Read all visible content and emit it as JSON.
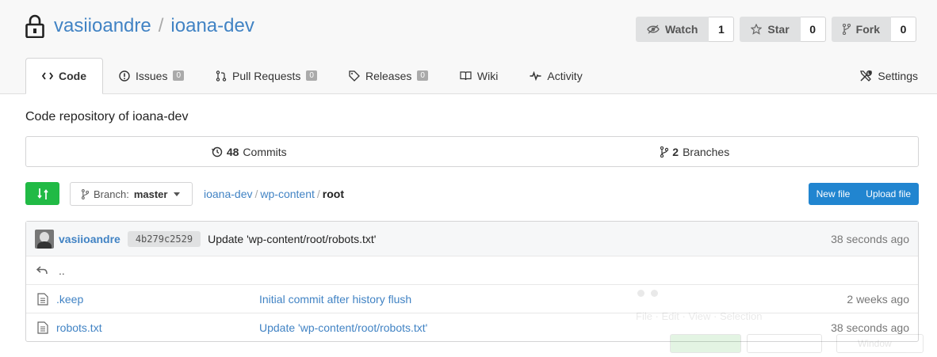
{
  "repo": {
    "owner": "vasiioandre",
    "separator": "/",
    "name": "ioana-dev"
  },
  "actions": {
    "watch": {
      "label": "Watch",
      "count": "1"
    },
    "star": {
      "label": "Star",
      "count": "0"
    },
    "fork": {
      "label": "Fork",
      "count": "0"
    }
  },
  "tabs": {
    "code": {
      "label": "Code"
    },
    "issues": {
      "label": "Issues",
      "badge": "0"
    },
    "pulls": {
      "label": "Pull Requests",
      "badge": "0"
    },
    "releases": {
      "label": "Releases",
      "badge": "0"
    },
    "wiki": {
      "label": "Wiki"
    },
    "activity": {
      "label": "Activity"
    },
    "settings": {
      "label": "Settings"
    }
  },
  "description": "Code repository of ioana-dev",
  "stats": {
    "commits": {
      "count": "48",
      "label": "Commits"
    },
    "branches": {
      "count": "2",
      "label": "Branches"
    }
  },
  "toolbar": {
    "branch_prefix": "Branch:",
    "branch_name": "master",
    "breadcrumb": [
      "ioana-dev",
      "wp-content",
      "root"
    ],
    "new_file": "New file",
    "upload_file": "Upload file"
  },
  "latest_commit": {
    "author": "vasiioandre",
    "sha": "4b279c2529",
    "message": "Update 'wp-content/root/robots.txt'",
    "time": "38 seconds ago"
  },
  "parent_dir": "..",
  "files": [
    {
      "name": ".keep",
      "commit": "Initial commit after history flush",
      "time": "2 weeks ago"
    },
    {
      "name": "robots.txt",
      "commit": "Update 'wp-content/root/robots.txt'",
      "time": "38 seconds ago"
    }
  ],
  "ghost_overlay": {
    "label_left": "File · Edit · View · Selection",
    "label_right": "Window"
  }
}
